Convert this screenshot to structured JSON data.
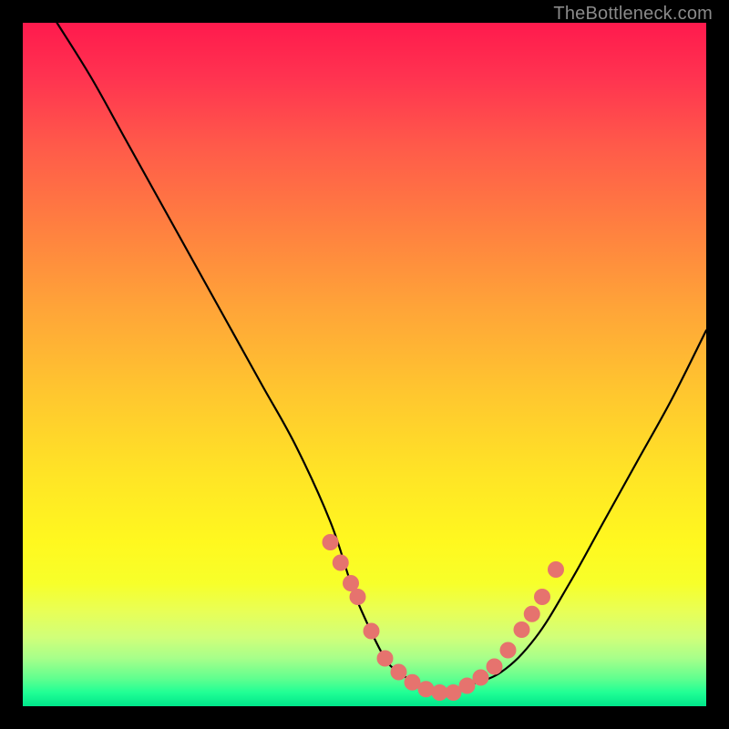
{
  "watermark": "TheBottleneck.com",
  "chart_data": {
    "type": "line",
    "title": "",
    "xlabel": "",
    "ylabel": "",
    "xlim": [
      0,
      100
    ],
    "ylim": [
      0,
      100
    ],
    "grid": false,
    "legend": false,
    "series": [
      {
        "name": "curve",
        "color": "#000000",
        "x": [
          5,
          10,
          15,
          20,
          25,
          30,
          35,
          40,
          45,
          48,
          50,
          53,
          55,
          58,
          60,
          63,
          65,
          70,
          75,
          80,
          85,
          90,
          95,
          100
        ],
        "y": [
          100,
          92,
          83,
          74,
          65,
          56,
          47,
          38,
          27,
          18,
          13,
          7,
          5,
          3,
          2,
          2,
          3,
          5,
          10,
          18,
          27,
          36,
          45,
          55
        ]
      }
    ],
    "markers": {
      "name": "beads",
      "color": "#e6736e",
      "radius_px": 9,
      "points_x": [
        45,
        46.5,
        48,
        49,
        51,
        53,
        55,
        57,
        59,
        61,
        63,
        65,
        67,
        69,
        71,
        73,
        74.5,
        76,
        78
      ],
      "points_y": [
        24,
        21,
        18,
        16,
        11,
        7,
        5,
        3.5,
        2.5,
        2,
        2,
        3,
        4.2,
        5.8,
        8.2,
        11.2,
        13.5,
        16,
        20
      ]
    },
    "background_gradient": {
      "direction": "top-to-bottom",
      "stops": [
        {
          "pos": 0.0,
          "color": "#ff1a4d"
        },
        {
          "pos": 0.3,
          "color": "#ff8040"
        },
        {
          "pos": 0.66,
          "color": "#ffe426"
        },
        {
          "pos": 0.86,
          "color": "#e9ff55"
        },
        {
          "pos": 1.0,
          "color": "#00e58a"
        }
      ]
    }
  }
}
